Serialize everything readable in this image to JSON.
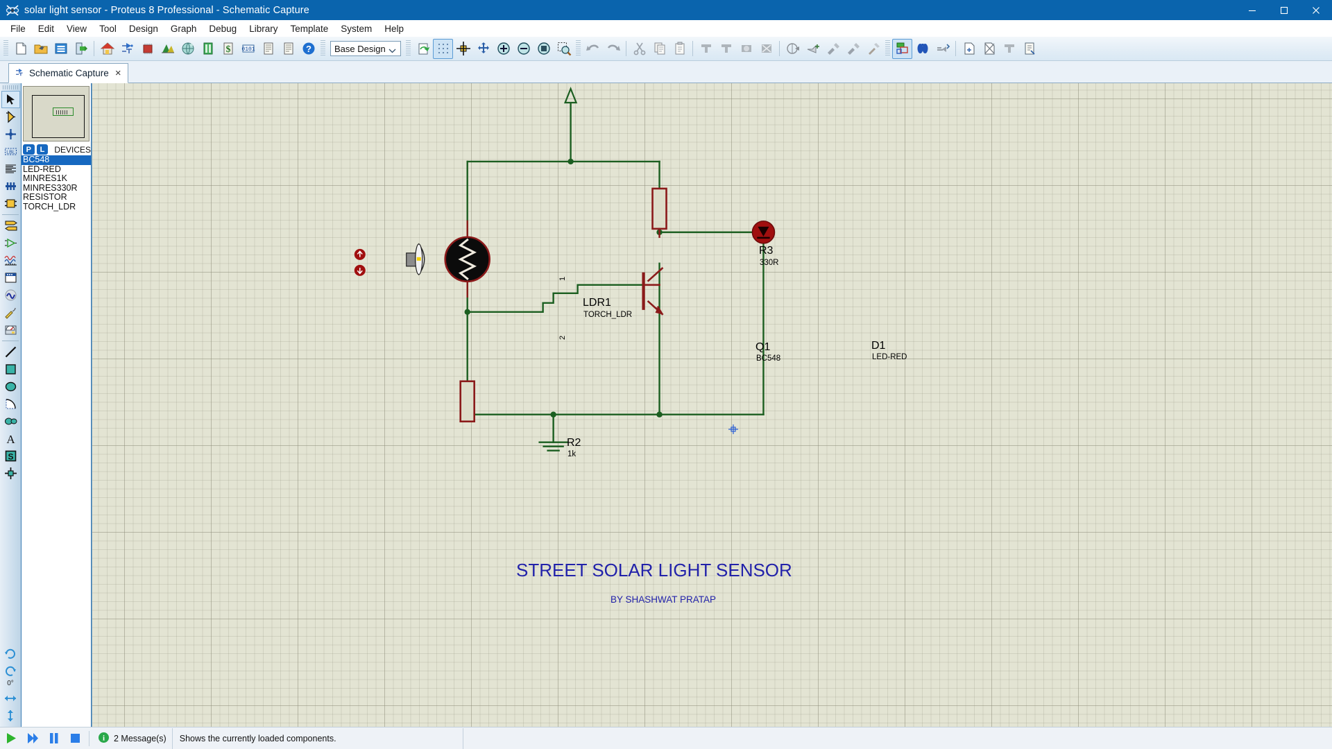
{
  "window": {
    "title": "solar light sensor - Proteus 8 Professional - Schematic Capture",
    "icon": "proteus-logo-icon",
    "minimize_label": "Minimize",
    "maximize_label": "Maximize",
    "close_label": "Close",
    "accent_color": "#0a64ad"
  },
  "menu": {
    "items": [
      {
        "label": "File"
      },
      {
        "label": "Edit"
      },
      {
        "label": "View"
      },
      {
        "label": "Tool"
      },
      {
        "label": "Design"
      },
      {
        "label": "Graph"
      },
      {
        "label": "Debug"
      },
      {
        "label": "Library"
      },
      {
        "label": "Template"
      },
      {
        "label": "System"
      },
      {
        "label": "Help"
      }
    ]
  },
  "toolbar": {
    "design_select_value": "Base Design",
    "groups": [
      {
        "name": "file",
        "buttons": [
          "new-file-icon",
          "open-folder-icon",
          "save-icon",
          "export-icon"
        ]
      },
      {
        "name": "modules",
        "buttons": [
          "home-icon",
          "schematic-capture-icon",
          "pcb-layout-icon",
          "3d-view-icon",
          "source-code-icon",
          "bill-of-materials-icon",
          "design-explorer-icon",
          "project-notes-icon",
          "report-icon",
          "help-icon"
        ]
      },
      {
        "name": "view",
        "buttons": [
          "refresh-icon",
          "toggle-grid-icon",
          "origin-icon",
          "pan-icon",
          "zoom-in-icon",
          "zoom-out-icon",
          "zoom-all-icon",
          "zoom-area-icon"
        ]
      },
      {
        "name": "edit",
        "buttons": [
          "undo-icon",
          "redo-icon",
          "cut-icon",
          "copy-icon",
          "paste-icon",
          "block-copy-icon",
          "block-move-icon",
          "block-rotate-icon",
          "block-delete-icon"
        ]
      },
      {
        "name": "tools",
        "buttons": [
          "pick-device-icon",
          "make-device-icon",
          "packaging-tool-icon",
          "decompose-icon",
          "hammer-icon"
        ]
      },
      {
        "name": "netlist",
        "buttons": [
          "pcb-netlist-icon",
          "search-icon",
          "property-assign-icon",
          "new-sheet-icon",
          "remove-sheet-icon",
          "goto-sheet-icon",
          "design-explorer2-icon"
        ]
      }
    ]
  },
  "tabs": [
    {
      "label": "Schematic Capture",
      "icon": "schematic-capture-icon",
      "close_label": "×",
      "active": true
    }
  ],
  "rail": {
    "tools": [
      {
        "name": "selection-mode-icon",
        "selected": true
      },
      {
        "name": "component-mode-icon",
        "selected": false
      },
      {
        "name": "junction-dot-mode-icon",
        "selected": false
      },
      {
        "name": "wire-label-mode-icon",
        "selected": false
      },
      {
        "name": "text-script-mode-icon",
        "selected": false
      },
      {
        "name": "bus-mode-icon",
        "selected": false
      },
      {
        "name": "subcircuit-mode-icon",
        "selected": false
      },
      {
        "name": "terminals-mode-icon",
        "selected": false
      },
      {
        "name": "device-pin-mode-icon",
        "selected": false
      },
      {
        "name": "graph-mode-icon",
        "selected": false
      },
      {
        "name": "tape-recorder-mode-icon",
        "selected": false
      },
      {
        "name": "generator-mode-icon",
        "selected": false
      },
      {
        "name": "voltage-probe-mode-icon",
        "selected": false
      },
      {
        "name": "virtual-instrument-mode-icon",
        "selected": false
      },
      {
        "name": "line-tool-icon",
        "selected": false
      },
      {
        "name": "box-tool-icon",
        "selected": false
      },
      {
        "name": "circle-tool-icon",
        "selected": false
      },
      {
        "name": "arc-tool-icon",
        "selected": false
      },
      {
        "name": "closed-path-tool-icon",
        "selected": false
      },
      {
        "name": "text-tool-icon",
        "selected": false
      },
      {
        "name": "symbol-tool-icon",
        "selected": false
      },
      {
        "name": "marker-tool-icon",
        "selected": false
      }
    ],
    "rotation": {
      "rotate-clockwise-icon": "Rotate Clockwise",
      "rotate-anticlockwise-icon": "Rotate Anti-Clockwise",
      "angle": "0°",
      "mirror-horizontal-icon": "Mirror Horizontally",
      "mirror-vertical-icon": "Mirror Vertically"
    }
  },
  "left_panel": {
    "preview_title": "preview-pane",
    "devices_header": {
      "pick_badge": "P",
      "library_badge": "L",
      "label": "DEVICES"
    },
    "devices": [
      {
        "label": "BC548",
        "selected": true
      },
      {
        "label": "LED-RED",
        "selected": false
      },
      {
        "label": "MINRES1K",
        "selected": false
      },
      {
        "label": "MINRES330R",
        "selected": false
      },
      {
        "label": "RESISTOR",
        "selected": false
      },
      {
        "label": "TORCH_LDR",
        "selected": false
      }
    ]
  },
  "schematic": {
    "title": "STREET SOLAR LIGHT SENSOR",
    "subtitle": "BY SHASHWAT PRATAP",
    "wire_color": "#1b5e20",
    "body_color": "#8b1a1a",
    "components": [
      {
        "name": "ldr",
        "ref": "LDR1",
        "value": "TORCH_LDR",
        "pin1": "1",
        "pin2": "2"
      },
      {
        "name": "resistor-r3",
        "ref": "R3",
        "value": "330R"
      },
      {
        "name": "resistor-r2",
        "ref": "R2",
        "value": "1k"
      },
      {
        "name": "transistor-q1",
        "ref": "Q1",
        "value": "BC548"
      },
      {
        "name": "led-d1",
        "ref": "D1",
        "value": "LED-RED"
      },
      {
        "name": "torch-light-source",
        "ref": "",
        "value": ""
      },
      {
        "name": "ground-symbol",
        "ref": "",
        "value": ""
      },
      {
        "name": "power-terminal",
        "ref": "",
        "value": ""
      }
    ]
  },
  "statusbar": {
    "buttons": [
      {
        "name": "simulation-play-button",
        "color": "#2db42d"
      },
      {
        "name": "simulation-step-button",
        "color": "#2b7ee8"
      },
      {
        "name": "simulation-pause-button",
        "color": "#2b7ee8"
      },
      {
        "name": "simulation-stop-button",
        "color": "#2b7ee8"
      }
    ],
    "messages_label": "2 Message(s)",
    "hint": "Shows the currently loaded components."
  }
}
